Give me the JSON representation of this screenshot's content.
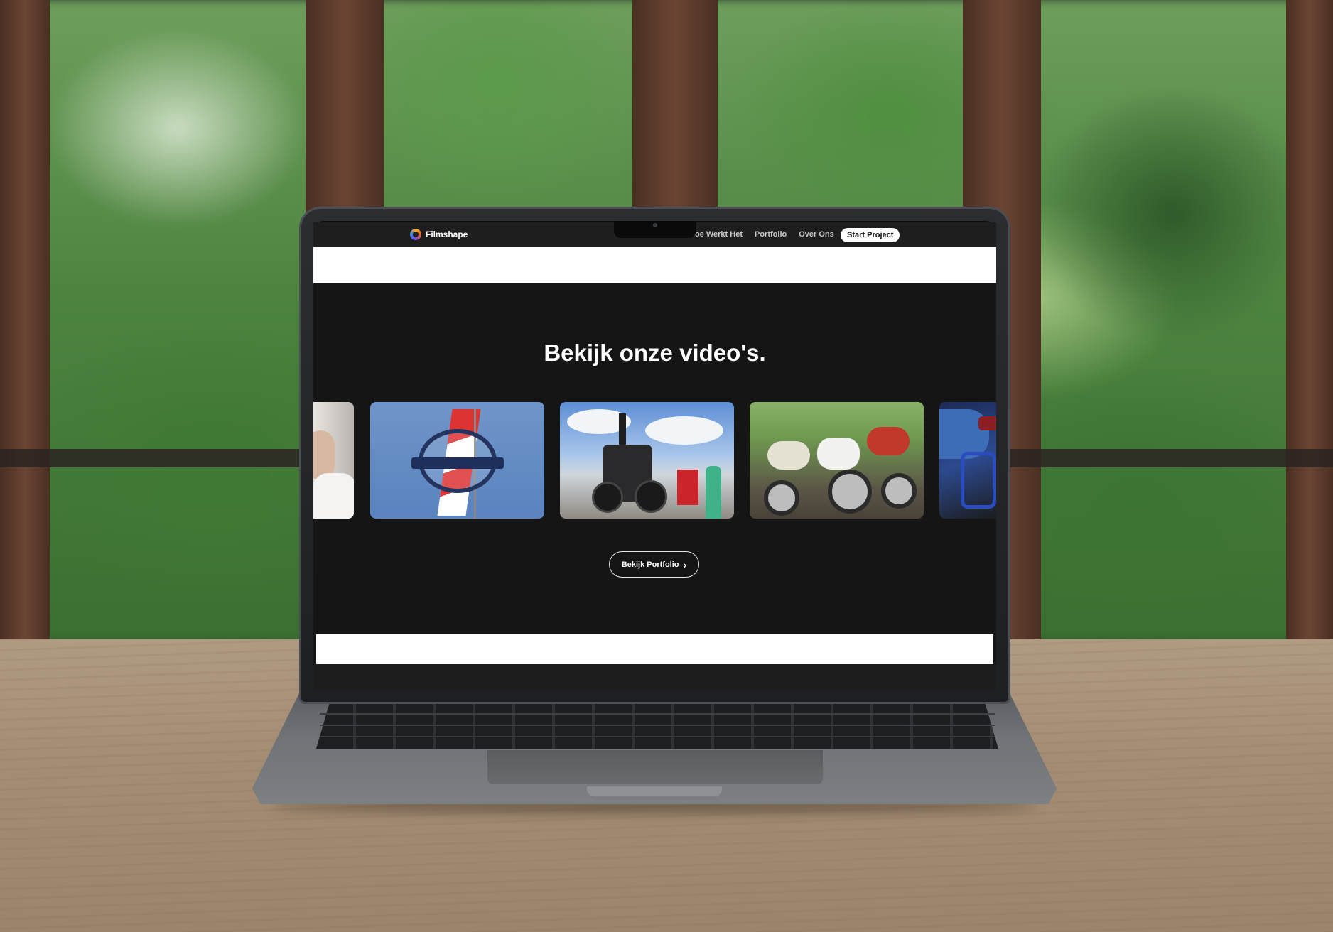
{
  "site": {
    "brand": "Filmshape",
    "brand_icon": "filmshape-logo-icon",
    "nav": {
      "links": [
        "Hoe Werkt Het",
        "Portfolio",
        "Over Ons"
      ],
      "cta_label": "Start Project"
    },
    "section": {
      "headline": "Bekijk onze video's.",
      "thumbnails": [
        {
          "subject": "people-portrait",
          "icon": "video-thumbnail"
        },
        {
          "subject": "oldtimerdag-logo-flag",
          "icon": "video-thumbnail"
        },
        {
          "subject": "steam-tractor",
          "icon": "video-thumbnail"
        },
        {
          "subject": "vintage-mopeds",
          "icon": "video-thumbnail"
        },
        {
          "subject": "blue-motorcycle",
          "icon": "video-thumbnail"
        }
      ],
      "portfolio_button_label": "Bekijk Portfolio",
      "portfolio_button_icon": "chevron-right-icon"
    }
  },
  "colors": {
    "page_background": "#151515",
    "nav_background": "#1e1e1e",
    "cta_background": "#ffffff",
    "text_primary": "#ffffff",
    "nav_text": "#c9c9c9"
  }
}
